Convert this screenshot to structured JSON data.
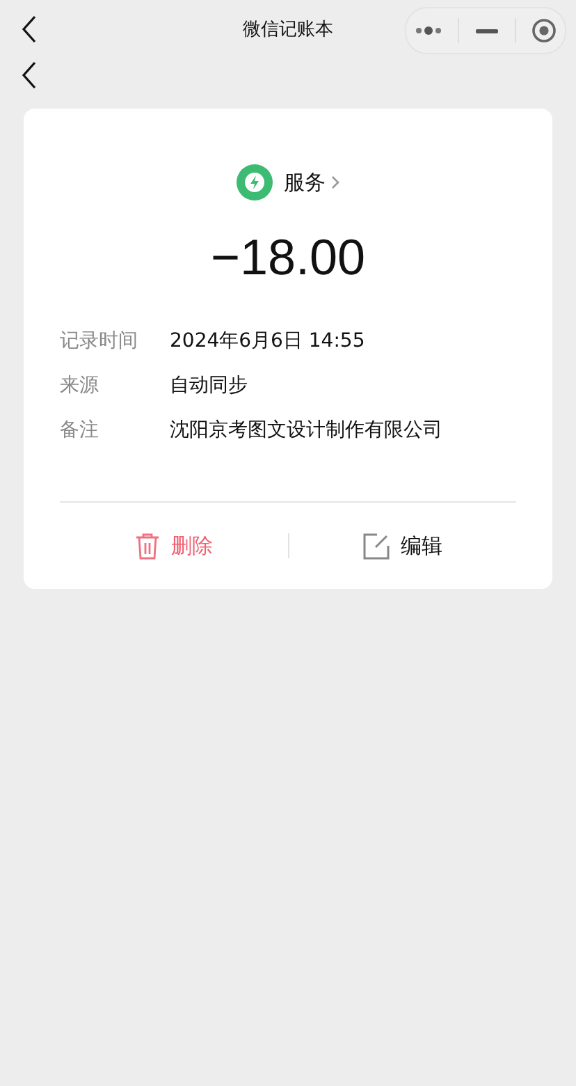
{
  "nav_bar": {
    "title": "微信记账本"
  },
  "category": {
    "label": "服务",
    "color": "#3dbb72"
  },
  "amount": "−18.00",
  "details": [
    {
      "label": "记录时间",
      "value": "2024年6月6日 14:55"
    },
    {
      "label": "来源",
      "value": "自动同步"
    },
    {
      "label": "备注",
      "value": "沈阳京考图文设计制作有限公司"
    }
  ],
  "actions": [
    {
      "kind": "delete",
      "label": "删除"
    },
    {
      "kind": "edit",
      "label": "编辑"
    }
  ]
}
